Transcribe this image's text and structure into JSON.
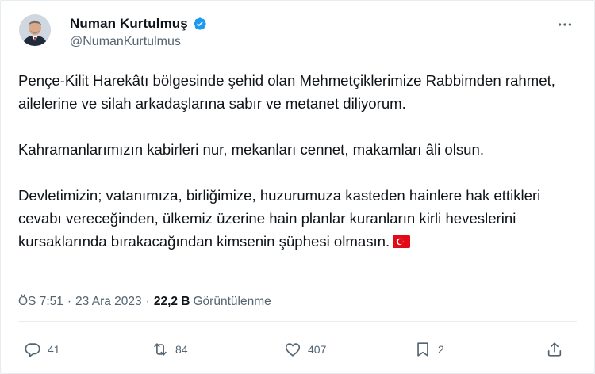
{
  "author": {
    "display_name": "Numan Kurtulmuş",
    "handle": "@NumanKurtulmus",
    "verified_icon": "verified-badge-icon",
    "avatar": "profile-photo"
  },
  "more_icon": "more-horizontal-icon",
  "post": {
    "paragraphs": [
      "Pençe-Kilit Harekâtı bölgesinde şehid olan Mehmetçiklerimize Rabbimden rahmet, ailelerine ve silah arkadaşlarına sabır ve metanet diliyorum.",
      "Kahramanlarımızın kabirleri nur, mekanları cennet, makamları âli olsun.",
      "Devletimizin; vatanımıza, birliğimize, huzurumuza kasteden hainlere hak ettikleri cevabı vereceğinden, ülkemiz üzerine hain planlar kuranların kirli heveslerini kursaklarında bırakacağından kimsenin şüphesi olmasın."
    ],
    "emoji": "turkey-flag-emoji"
  },
  "meta": {
    "time": "ÖS 7:51",
    "dot": "·",
    "date": "23 Ara 2023",
    "views_count": "22,2 B",
    "views_label": "Görüntülenme"
  },
  "actions": {
    "replies": "41",
    "reposts": "84",
    "likes": "407",
    "bookmarks": "2"
  },
  "colors": {
    "text": "#0f1419",
    "secondary": "#536471",
    "verified": "#1d9bf0",
    "flag_red": "#e30a17"
  }
}
